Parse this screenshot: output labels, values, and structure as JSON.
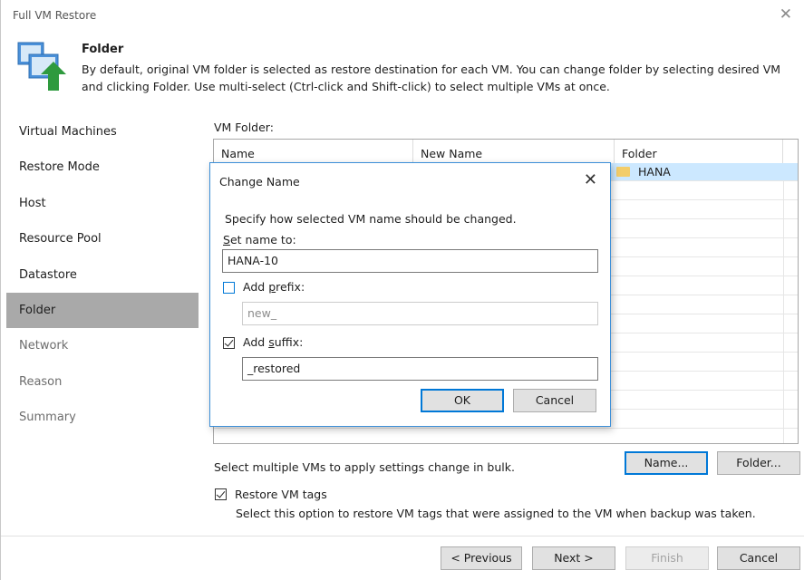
{
  "window": {
    "title": "Full VM Restore",
    "close_icon": "close-icon"
  },
  "header": {
    "title": "Folder",
    "description": "By default, original VM folder is selected as restore destination for each VM. You can change folder by selecting desired VM and clicking Folder. Use multi-select (Ctrl-click and Shift-click) to select multiple VMs at once.",
    "icon": "folder-restore-icon"
  },
  "nav": {
    "items": [
      {
        "label": "Virtual Machines",
        "state": "normal"
      },
      {
        "label": "Restore Mode",
        "state": "normal"
      },
      {
        "label": "Host",
        "state": "normal"
      },
      {
        "label": "Resource Pool",
        "state": "normal"
      },
      {
        "label": "Datastore",
        "state": "normal"
      },
      {
        "label": "Folder",
        "state": "active"
      },
      {
        "label": "Network",
        "state": "disabled"
      },
      {
        "label": "Reason",
        "state": "disabled"
      },
      {
        "label": "Summary",
        "state": "disabled"
      }
    ]
  },
  "vm_folder": {
    "label": "VM Folder:",
    "columns": [
      "Name",
      "New Name",
      "Folder"
    ],
    "rows": [
      {
        "name": "",
        "new_name": "",
        "folder": "HANA"
      }
    ]
  },
  "bulk": {
    "text": "Select multiple VMs to apply settings change in bulk.",
    "name_button": "Name...",
    "folder_button": "Folder..."
  },
  "tags": {
    "label": "Restore VM tags",
    "checked": true,
    "description": "Select this option to restore VM tags that were assigned to the VM when backup was taken."
  },
  "footer": {
    "previous": "< Previous",
    "next": "Next >",
    "finish": "Finish",
    "cancel": "Cancel"
  },
  "modal": {
    "title": "Change Name",
    "instruction": "Specify how selected VM name should be changed.",
    "set_name_label_accel": "S",
    "set_name_label_rest": "et name to:",
    "set_name_value": "HANA-10",
    "prefix_label_pre": "Add ",
    "prefix_label_accel": "p",
    "prefix_label_rest": "refix:",
    "prefix_checked": false,
    "prefix_value": "new_",
    "suffix_label_pre": "Add ",
    "suffix_label_accel": "s",
    "suffix_label_rest": "uffix:",
    "suffix_checked": true,
    "suffix_value": "_restored",
    "ok": "OK",
    "cancel": "Cancel"
  }
}
